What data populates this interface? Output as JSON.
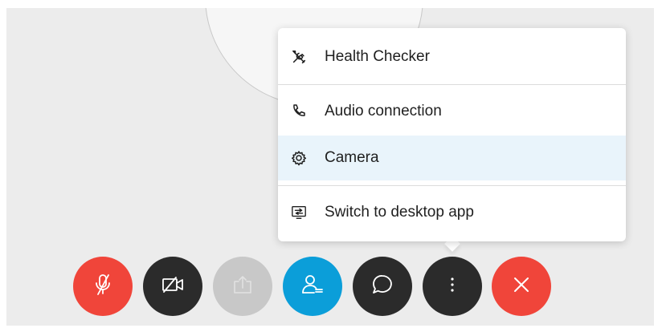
{
  "menu": {
    "items": [
      {
        "label": "Health Checker",
        "icon": "tools-icon"
      },
      {
        "label": "Audio connection",
        "icon": "phone-icon"
      },
      {
        "label": "Camera",
        "icon": "gear-icon"
      },
      {
        "label": "Switch to desktop app",
        "icon": "desktop-switch-icon"
      }
    ],
    "highlighted_item": "Camera"
  },
  "controls": [
    {
      "name": "mute-button",
      "icon": "microphone-muted-icon",
      "color": "#f0453a"
    },
    {
      "name": "video-button",
      "icon": "video-off-icon",
      "color": "#2b2b2b"
    },
    {
      "name": "share-button",
      "icon": "share-icon",
      "color": "#c8c8c8"
    },
    {
      "name": "participants-button",
      "icon": "participants-icon",
      "color": "#0b9ed9"
    },
    {
      "name": "chat-button",
      "icon": "chat-icon",
      "color": "#2b2b2b"
    },
    {
      "name": "more-options-button",
      "icon": "more-vertical-icon",
      "color": "#2b2b2b"
    },
    {
      "name": "leave-button",
      "icon": "close-icon",
      "color": "#f0453a"
    }
  ],
  "colors": {
    "background": "#ececec",
    "menu_background": "#ffffff",
    "highlight": "#e9f4fb"
  }
}
